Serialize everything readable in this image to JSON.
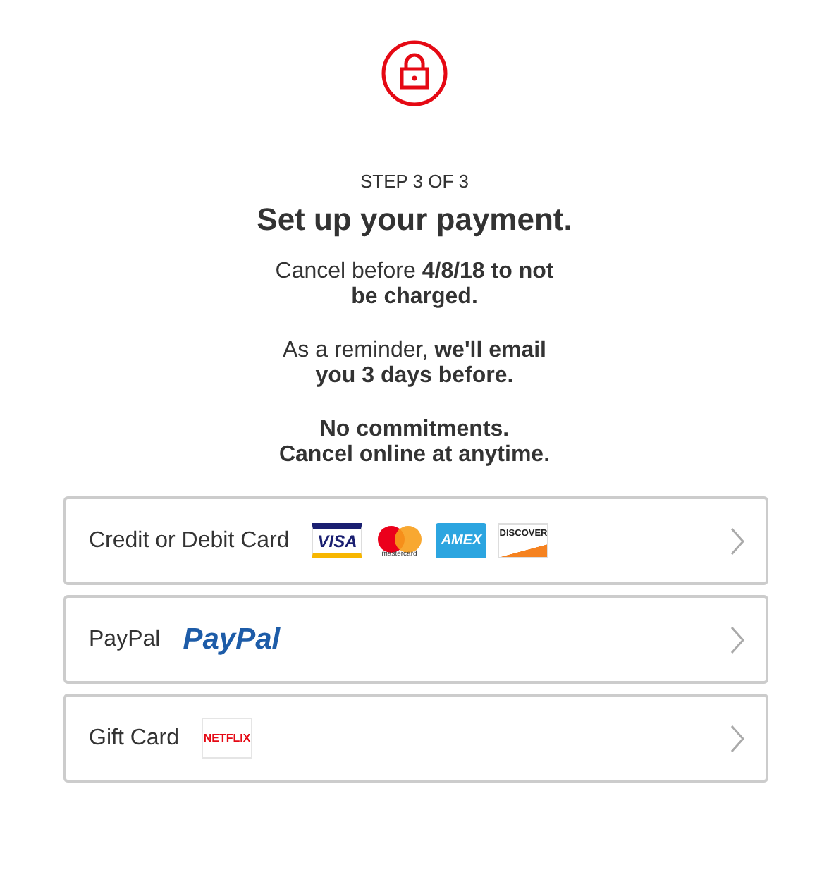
{
  "step": "STEP 3 OF 3",
  "title": "Set up your payment.",
  "paragraphs": [
    "Cancel before **4/8/18 to not be charged.**",
    "As a reminder, **we'll email you 3 days before.**",
    "**No commitments.**\n**Cancel online at anytime.**"
  ],
  "options": [
    {
      "label": "Credit or Debit Card",
      "logos": [
        {
          "kind": "visa",
          "text": "VISA"
        },
        {
          "kind": "mastercard",
          "text": "mastercard"
        },
        {
          "kind": "amex",
          "text": "AMEX"
        },
        {
          "kind": "discover",
          "text": "DISCOVER"
        }
      ]
    },
    {
      "label": "PayPal",
      "logos": [
        {
          "kind": "paypal",
          "text": "PayPal"
        }
      ]
    },
    {
      "label": "Gift Card",
      "logos": [
        {
          "kind": "netflix",
          "text": "NETFLIX"
        }
      ]
    }
  ]
}
